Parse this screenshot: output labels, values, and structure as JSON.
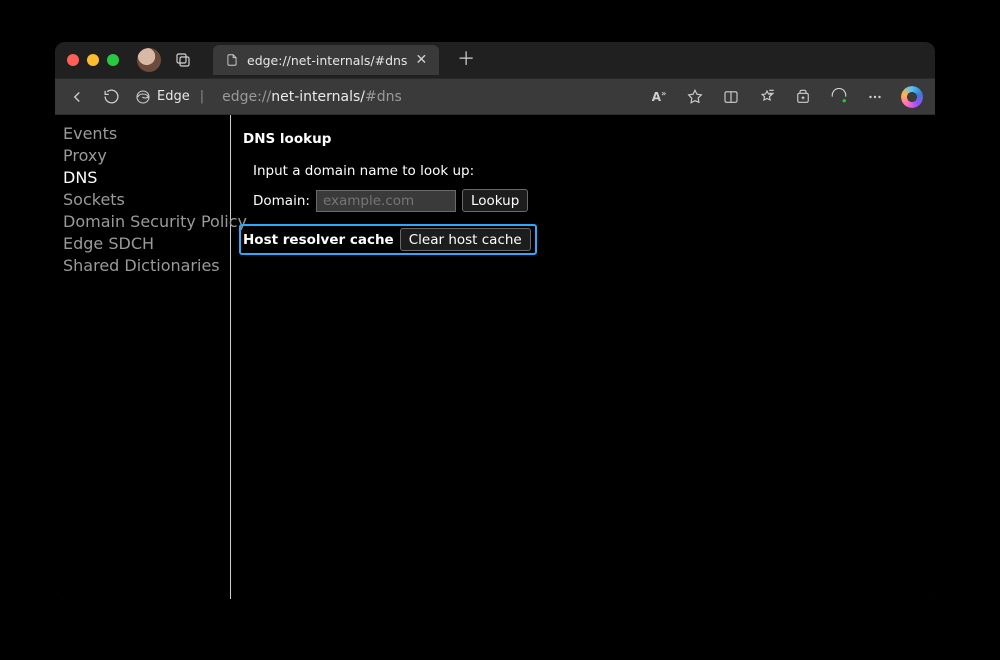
{
  "window": {
    "tab_title": "edge://net-internals/#dns"
  },
  "addr": {
    "edge_label": "Edge",
    "url_prefix": "edge://",
    "url_main": "net-internals/",
    "url_hash": "#dns"
  },
  "sidebar": {
    "items": [
      {
        "label": "Events",
        "active": false
      },
      {
        "label": "Proxy",
        "active": false
      },
      {
        "label": "DNS",
        "active": true
      },
      {
        "label": "Sockets",
        "active": false
      },
      {
        "label": "Domain Security Policy",
        "active": false
      },
      {
        "label": "Edge SDCH",
        "active": false
      },
      {
        "label": "Shared Dictionaries",
        "active": false
      }
    ]
  },
  "main": {
    "dns_title": "DNS lookup",
    "instruction": "Input a domain name to look up:",
    "domain_label": "Domain:",
    "domain_placeholder": "example.com",
    "lookup_button": "Lookup",
    "host_cache_title": "Host resolver cache",
    "clear_button": "Clear host cache"
  }
}
